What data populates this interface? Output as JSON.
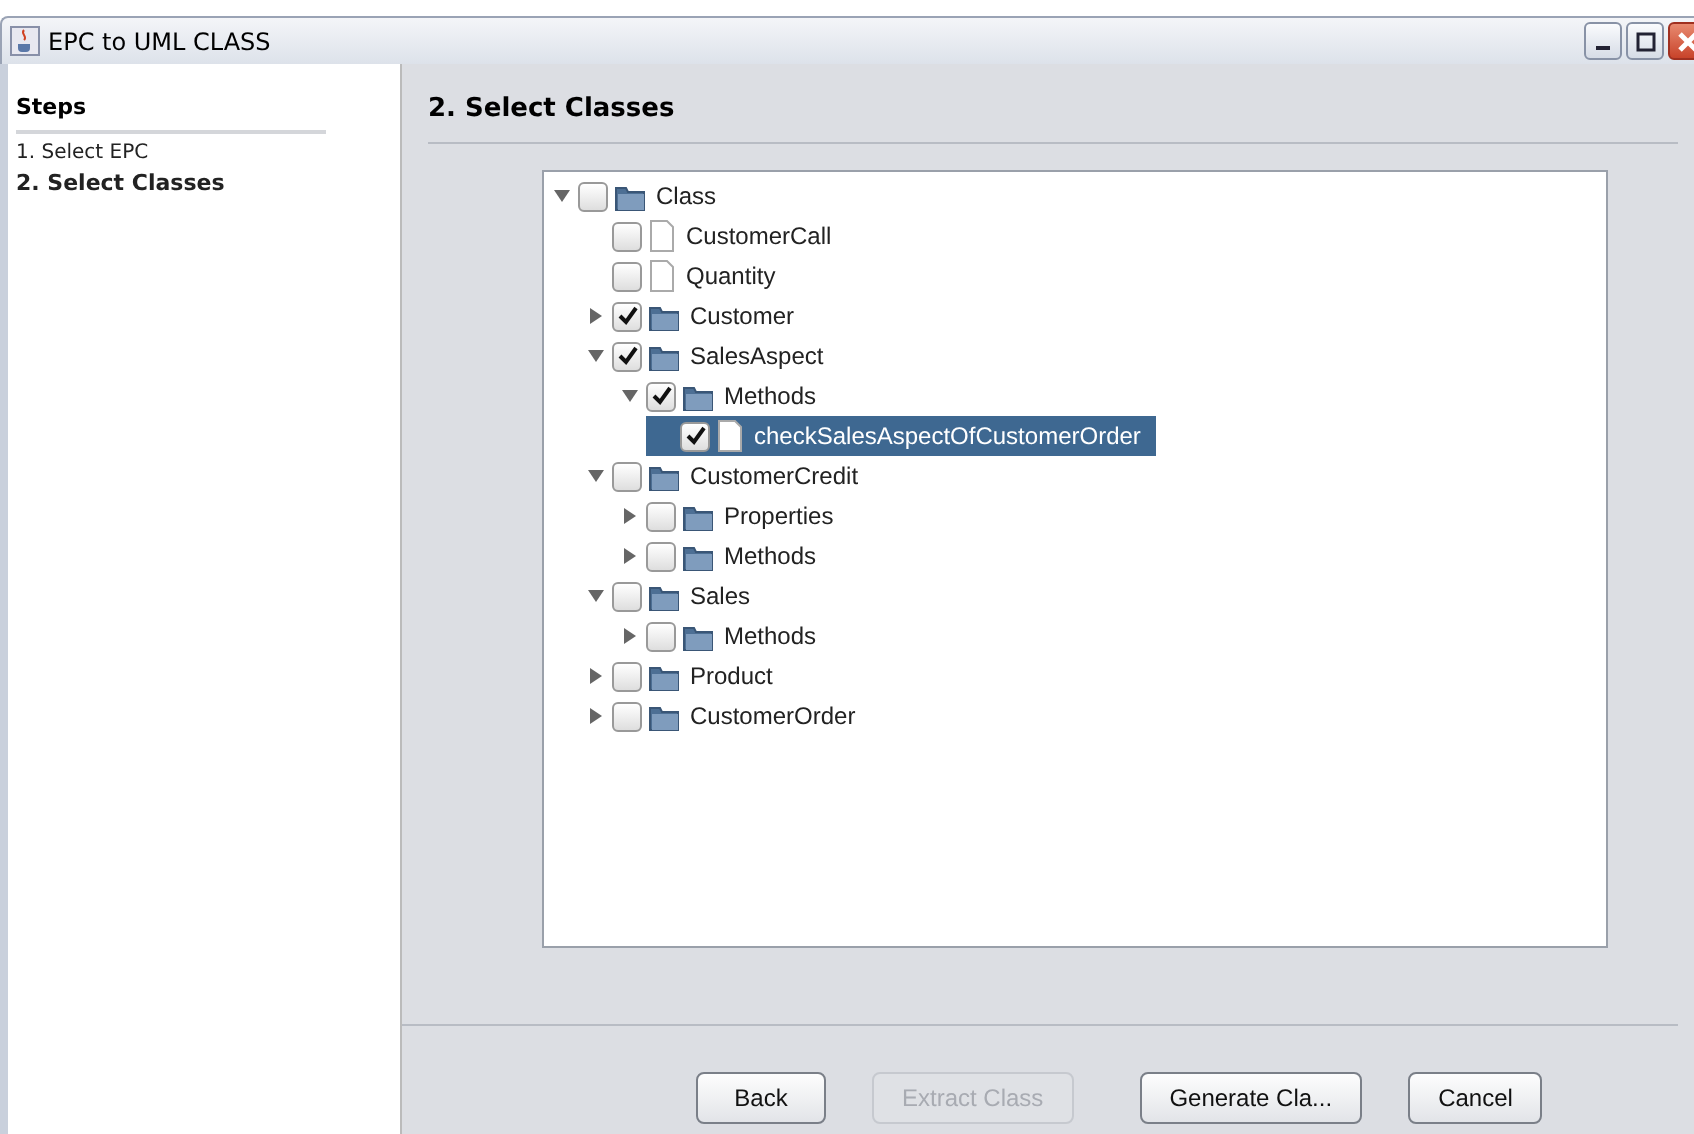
{
  "window": {
    "title": "EPC to UML CLASS"
  },
  "sidebar": {
    "title": "Steps",
    "items": [
      {
        "label": "1. Select EPC",
        "selected": false
      },
      {
        "label": "2. Select Classes",
        "selected": true
      }
    ]
  },
  "page_title": "2. Select Classes",
  "tree": [
    {
      "label": "Class",
      "kind": "folder",
      "checked": false,
      "expanded": true,
      "selected": false,
      "children": [
        {
          "label": "CustomerCall",
          "kind": "file",
          "checked": false,
          "selected": false
        },
        {
          "label": "Quantity",
          "kind": "file",
          "checked": false,
          "selected": false
        },
        {
          "label": "Customer",
          "kind": "folder",
          "checked": true,
          "expanded": false,
          "selected": false
        },
        {
          "label": "SalesAspect",
          "kind": "folder",
          "checked": true,
          "expanded": true,
          "selected": false,
          "children": [
            {
              "label": "Methods",
              "kind": "folder",
              "checked": true,
              "expanded": true,
              "selected": false,
              "children": [
                {
                  "label": "checkSalesAspectOfCustomerOrder",
                  "kind": "file",
                  "checked": true,
                  "selected": true
                }
              ]
            }
          ]
        },
        {
          "label": "CustomerCredit",
          "kind": "folder",
          "checked": false,
          "expanded": true,
          "selected": false,
          "children": [
            {
              "label": "Properties",
              "kind": "folder",
              "checked": false,
              "expanded": false,
              "selected": false
            },
            {
              "label": "Methods",
              "kind": "folder",
              "checked": false,
              "expanded": false,
              "selected": false
            }
          ]
        },
        {
          "label": "Sales",
          "kind": "folder",
          "checked": false,
          "expanded": true,
          "selected": false,
          "children": [
            {
              "label": "Methods",
              "kind": "folder",
              "checked": false,
              "expanded": false,
              "selected": false
            }
          ]
        },
        {
          "label": "Product",
          "kind": "folder",
          "checked": false,
          "expanded": false,
          "selected": false
        },
        {
          "label": "CustomerOrder",
          "kind": "folder",
          "checked": false,
          "expanded": false,
          "selected": false
        }
      ]
    }
  ],
  "buttons": [
    {
      "label": "Back",
      "disabled": false
    },
    {
      "label": "Extract Class",
      "disabled": true
    },
    {
      "label": "Generate Cla...",
      "disabled": false
    },
    {
      "label": "Cancel",
      "disabled": false
    }
  ]
}
